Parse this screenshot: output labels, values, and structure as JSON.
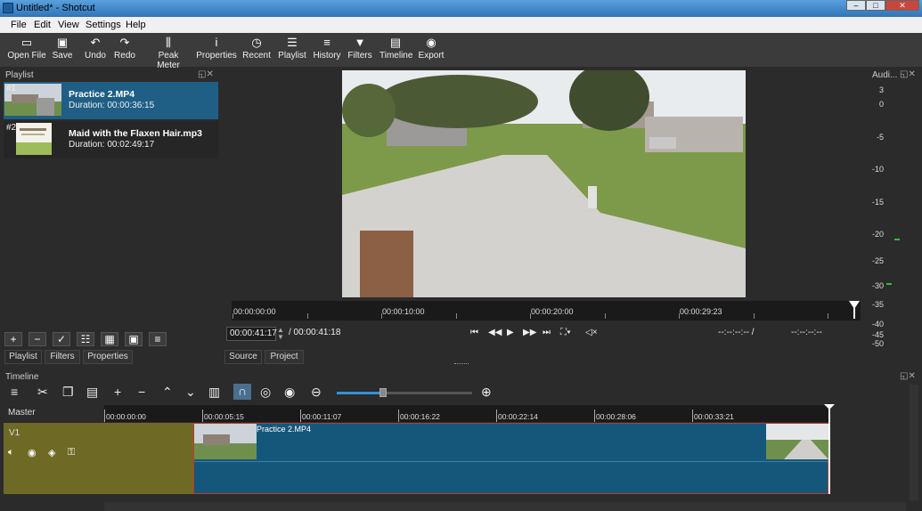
{
  "window": {
    "title": "Untitled* - Shotcut"
  },
  "menu": [
    "File",
    "Edit",
    "View",
    "Settings",
    "Help"
  ],
  "toolbar": [
    {
      "label": "Open File",
      "icon": "folder-icon"
    },
    {
      "label": "Save",
      "icon": "save-icon"
    },
    {
      "label": "Undo",
      "icon": "undo-icon"
    },
    {
      "label": "Redo",
      "icon": "redo-icon"
    },
    {
      "label": "Peak Meter",
      "icon": "peak-meter-icon"
    },
    {
      "label": "Properties",
      "icon": "info-icon"
    },
    {
      "label": "Recent",
      "icon": "clock-icon"
    },
    {
      "label": "Playlist",
      "icon": "list-icon"
    },
    {
      "label": "History",
      "icon": "history-icon"
    },
    {
      "label": "Filters",
      "icon": "funnel-icon"
    },
    {
      "label": "Timeline",
      "icon": "timeline-icon"
    },
    {
      "label": "Export",
      "icon": "export-icon"
    }
  ],
  "playlist": {
    "title": "Playlist",
    "items": [
      {
        "num": "#1",
        "name": "Practice 2.MP4",
        "duration": "Duration: 00:00:36:15"
      },
      {
        "num": "#2",
        "name": "Maid with the Flaxen Hair.mp3",
        "duration": "Duration: 00:02:49:17"
      }
    ],
    "tabs": [
      "Playlist",
      "Filters",
      "Properties"
    ]
  },
  "player": {
    "ruler_ticks": [
      "00:00:00:00",
      "00:00:10:00",
      "00:00:20:00",
      "00:00:29:23"
    ],
    "position": "00:00:41:17",
    "duration": "/ 00:00:41:18",
    "in_point": "--:--:--:-- /",
    "out_point": "--:--:--:--",
    "tabs": [
      "Source",
      "Project"
    ]
  },
  "audio": {
    "title": "Audi...",
    "scale": [
      "3",
      "0",
      "-5",
      "-10",
      "-15",
      "-20",
      "-25",
      "-30",
      "-35",
      "-40",
      "-45",
      "-50"
    ]
  },
  "timeline": {
    "title": "Timeline",
    "master_label": "Master",
    "track_label": "V1",
    "clip_label": "Practice 2.MP4",
    "ticks": [
      "00:00:00:00",
      "00:00:05:15",
      "00:00:11:07",
      "00:00:16:22",
      "00:00:22:14",
      "00:00:28:06",
      "00:00:33:21"
    ]
  },
  "colors": {
    "selection": "#1f5f86",
    "clip": "#15577a",
    "track": "#6e6a25",
    "playhead": "#ffffff"
  }
}
